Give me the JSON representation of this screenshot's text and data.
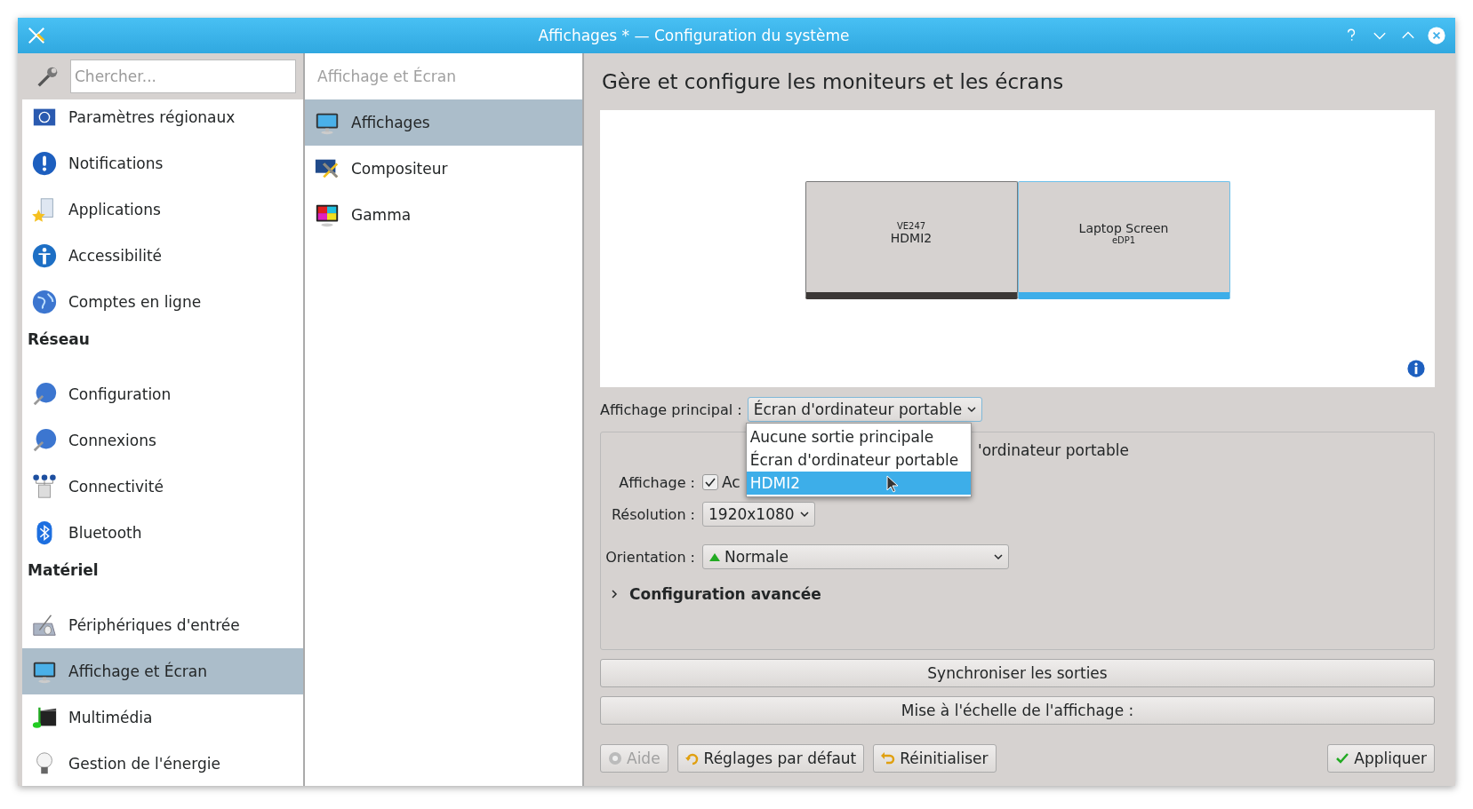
{
  "window": {
    "title": "Affichages * — Configuration du système"
  },
  "sidebar": {
    "search": {
      "placeholder": "Chercher..."
    },
    "items": [
      {
        "kind": "item",
        "label": "Paramètres régionaux",
        "selected": false
      },
      {
        "kind": "item",
        "label": "Notifications",
        "selected": false
      },
      {
        "kind": "item",
        "label": "Applications",
        "selected": false
      },
      {
        "kind": "item",
        "label": "Accessibilité",
        "selected": false
      },
      {
        "kind": "item",
        "label": "Comptes en ligne",
        "selected": false
      },
      {
        "kind": "section",
        "label": "Réseau"
      },
      {
        "kind": "item",
        "label": "Configuration",
        "selected": false
      },
      {
        "kind": "item",
        "label": "Connexions",
        "selected": false
      },
      {
        "kind": "item",
        "label": "Connectivité",
        "selected": false
      },
      {
        "kind": "item",
        "label": "Bluetooth",
        "selected": false
      },
      {
        "kind": "section",
        "label": "Matériel"
      },
      {
        "kind": "item",
        "label": "Périphériques d'entrée",
        "selected": false
      },
      {
        "kind": "item",
        "label": "Affichage et Écran",
        "selected": true
      },
      {
        "kind": "item",
        "label": "Multimédia",
        "selected": false
      },
      {
        "kind": "item",
        "label": "Gestion de l'énergie",
        "selected": false
      }
    ]
  },
  "subpanel": {
    "header": "Affichage et Écran",
    "items": [
      {
        "label": "Affichages",
        "selected": true
      },
      {
        "label": "Compositeur",
        "selected": false
      },
      {
        "label": "Gamma",
        "selected": false
      }
    ]
  },
  "main": {
    "heading": "Gère et configure les moniteurs et les écrans",
    "monitors": [
      {
        "kind": "model_first",
        "model": "VE247",
        "name": "HDMI2",
        "selected": false
      },
      {
        "kind": "name_first",
        "name": "Laptop Screen",
        "connector": "eDP1",
        "selected": true
      }
    ],
    "primary": {
      "label": "Affichage principal :",
      "value": "Écran d'ordinateur portable",
      "expanded": true,
      "options": [
        {
          "label": "Aucune sortie principale",
          "highlighted": false
        },
        {
          "label": "Écran d'ordinateur portable",
          "highlighted": false
        },
        {
          "label": "HDMI2",
          "highlighted": true
        }
      ]
    },
    "output": {
      "title": "'ordinateur portable",
      "display_label": "Affichage :",
      "enabled": {
        "checked": true,
        "label": "Ac"
      },
      "resolution_label": "Résolution :",
      "resolution": "1920x1080",
      "orientation_label": "Orientation :",
      "orientation": "Normale",
      "advanced": {
        "label": "Configuration avancée",
        "expanded": false
      }
    },
    "sync_button": "Synchroniser les sorties",
    "scale_button": "Mise à l'échelle de l'affichage :"
  },
  "footer": {
    "buttons": [
      {
        "kind": "help",
        "label": "Aide",
        "disabled": true
      },
      {
        "kind": "defaults",
        "label": "Réglages par défaut",
        "disabled": false
      },
      {
        "kind": "reset",
        "label": "Réinitialiser",
        "disabled": false
      },
      {
        "kind": "apply",
        "label": "Appliquer",
        "disabled": false
      }
    ]
  }
}
